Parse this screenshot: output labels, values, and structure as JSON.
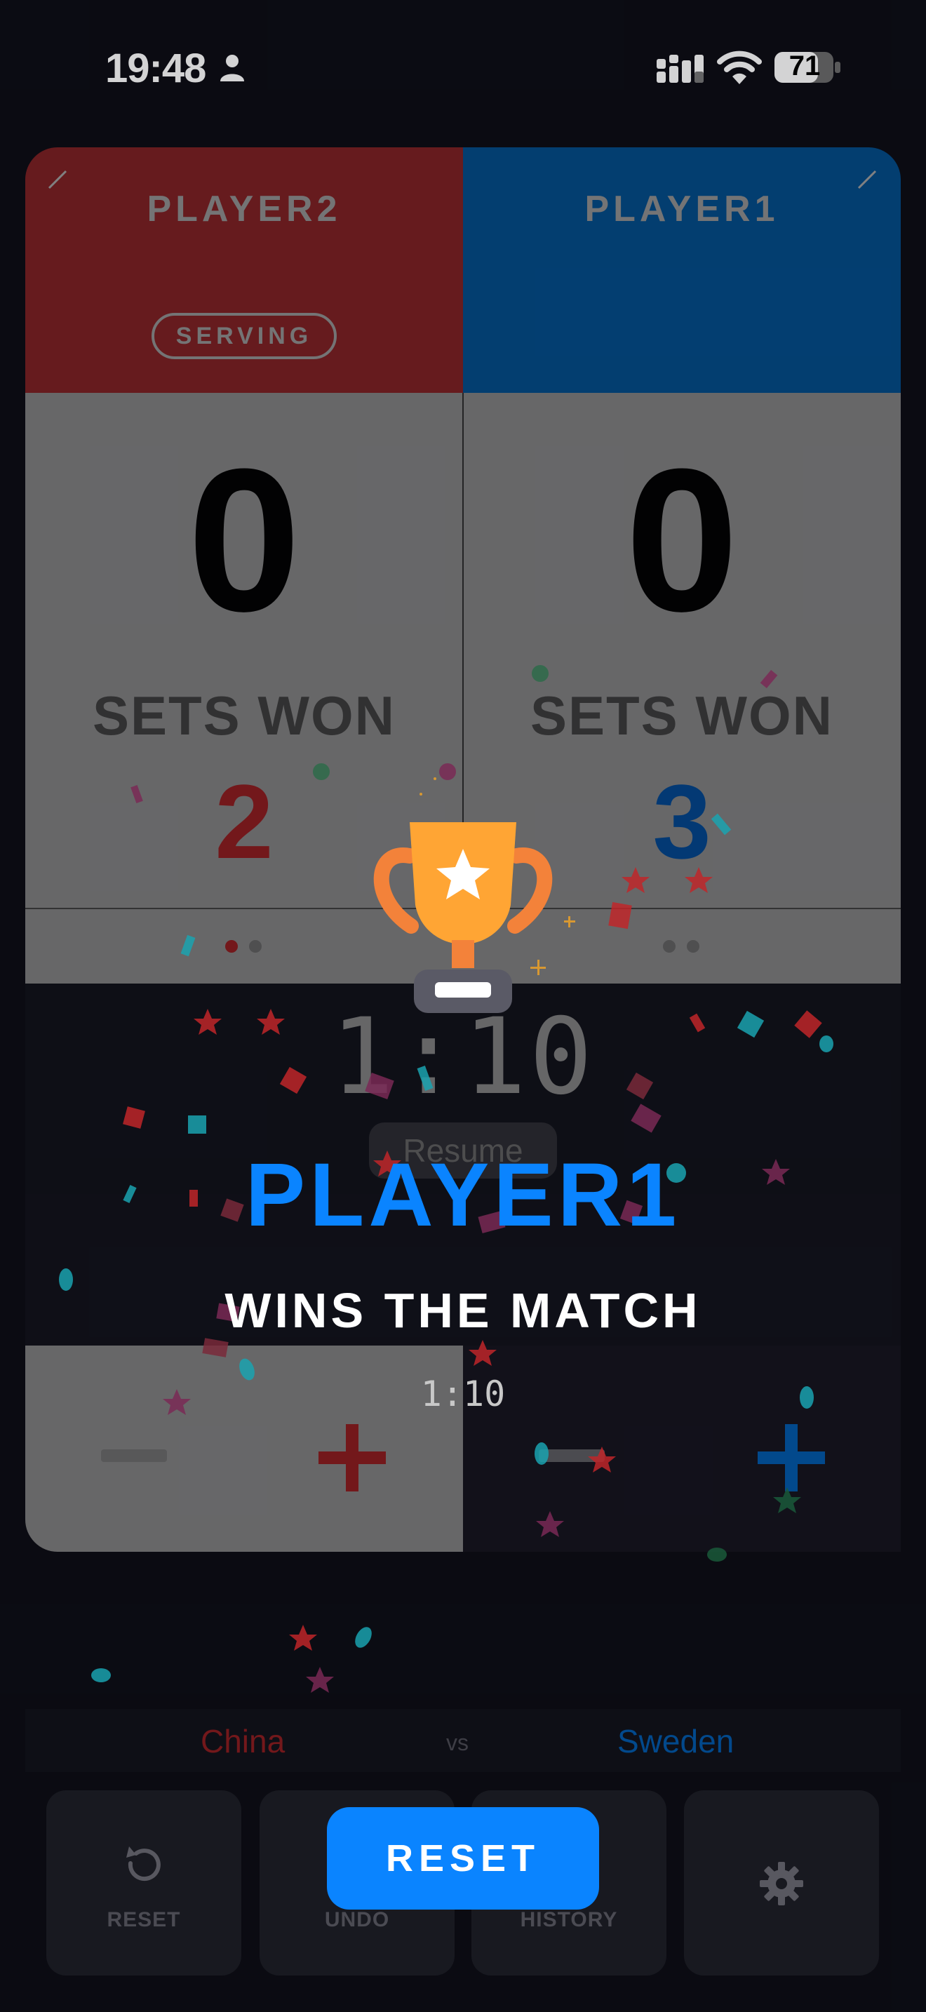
{
  "status": {
    "time": "19:48",
    "battery": "71"
  },
  "players": {
    "left": {
      "name": "PLAYER2",
      "serving_label": "SERVING",
      "score": "0",
      "sets_label": "SETS WON",
      "sets_won": "2",
      "color": "#a52024"
    },
    "right": {
      "name": "PLAYER1",
      "score": "0",
      "sets_label": "SETS WON",
      "sets_won": "3",
      "color": "#0057a8"
    }
  },
  "timer": {
    "value": "1:10",
    "resume_label": "Resume"
  },
  "controls": {
    "minus": "−",
    "plus": "+"
  },
  "teams": {
    "left": "China",
    "vs": "vs",
    "right": "Sweden"
  },
  "toolbar": {
    "reset_label": "RESET",
    "undo_label": "UNDO",
    "history_label": "HISTORY"
  },
  "overlay": {
    "winner": "PLAYER1",
    "subtitle": "WINS THE MATCH",
    "duration": "1:10",
    "reset_button": "RESET"
  },
  "colors": {
    "accent": "#0a84ff",
    "red": "#a52024",
    "blue": "#0057a8"
  }
}
